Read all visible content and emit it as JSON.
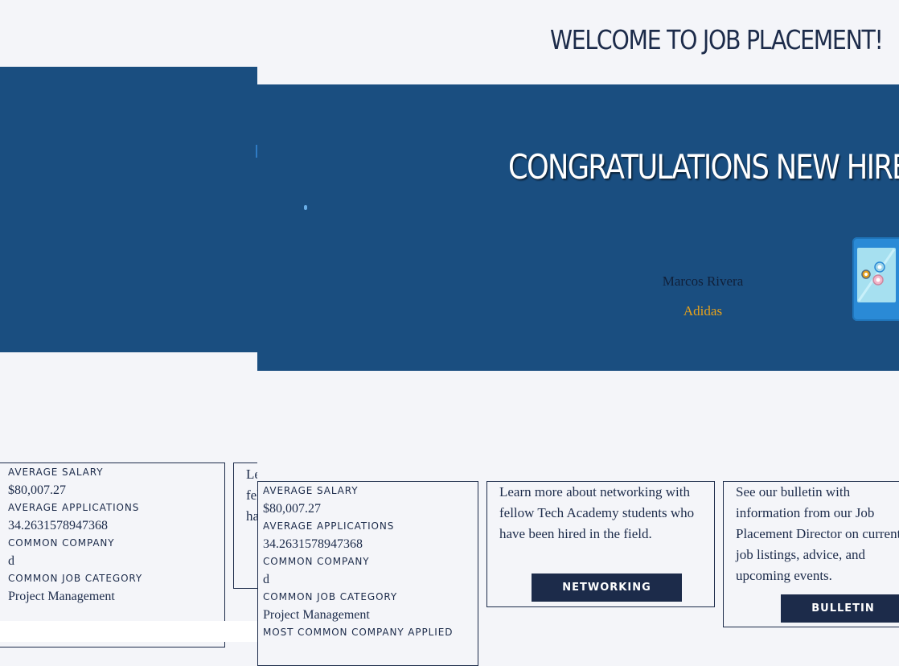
{
  "page": {
    "title": "WELCOME TO JOB PLACEMENT!"
  },
  "banner": {
    "heading": "CONGRATULATIONS NEW HIRES!!!",
    "hire_name": "Marcos Rivera",
    "hire_company": "Adidas"
  },
  "stats": {
    "avg_salary_label": "AVERAGE SALARY",
    "avg_salary_value": "$80,007.27",
    "avg_applications_label": "AVERAGE APPLICATIONS",
    "avg_applications_value": "34.2631578947368",
    "common_company_label": "COMMON COMPANY",
    "common_company_value": "d",
    "common_job_category_label": "COMMON JOB CATEGORY",
    "common_job_category_value": "Project Management",
    "most_common_company_applied_label": "MOST COMMON COMPANY APPLIED"
  },
  "ghost_card": {
    "text": "Learn more about networking with fellow Tech Academy students who have been hired in the field."
  },
  "networking": {
    "text": "Learn more about networking with fellow Tech Academy students who have been hired in the field.",
    "button_label": "NETWORKING"
  },
  "bulletin": {
    "text": "See our bulletin with information from our Job Placement Director on current job listings, advice, and upcoming events.",
    "button_label": "BULLETIN"
  },
  "colors": {
    "navy": "#1c2b4a",
    "banner_blue": "#1a4e80",
    "accent_orange": "#e8a21a",
    "background": "#f4f5f9"
  },
  "icons": {
    "hero_illustration": "tablet-illustration-icon"
  }
}
